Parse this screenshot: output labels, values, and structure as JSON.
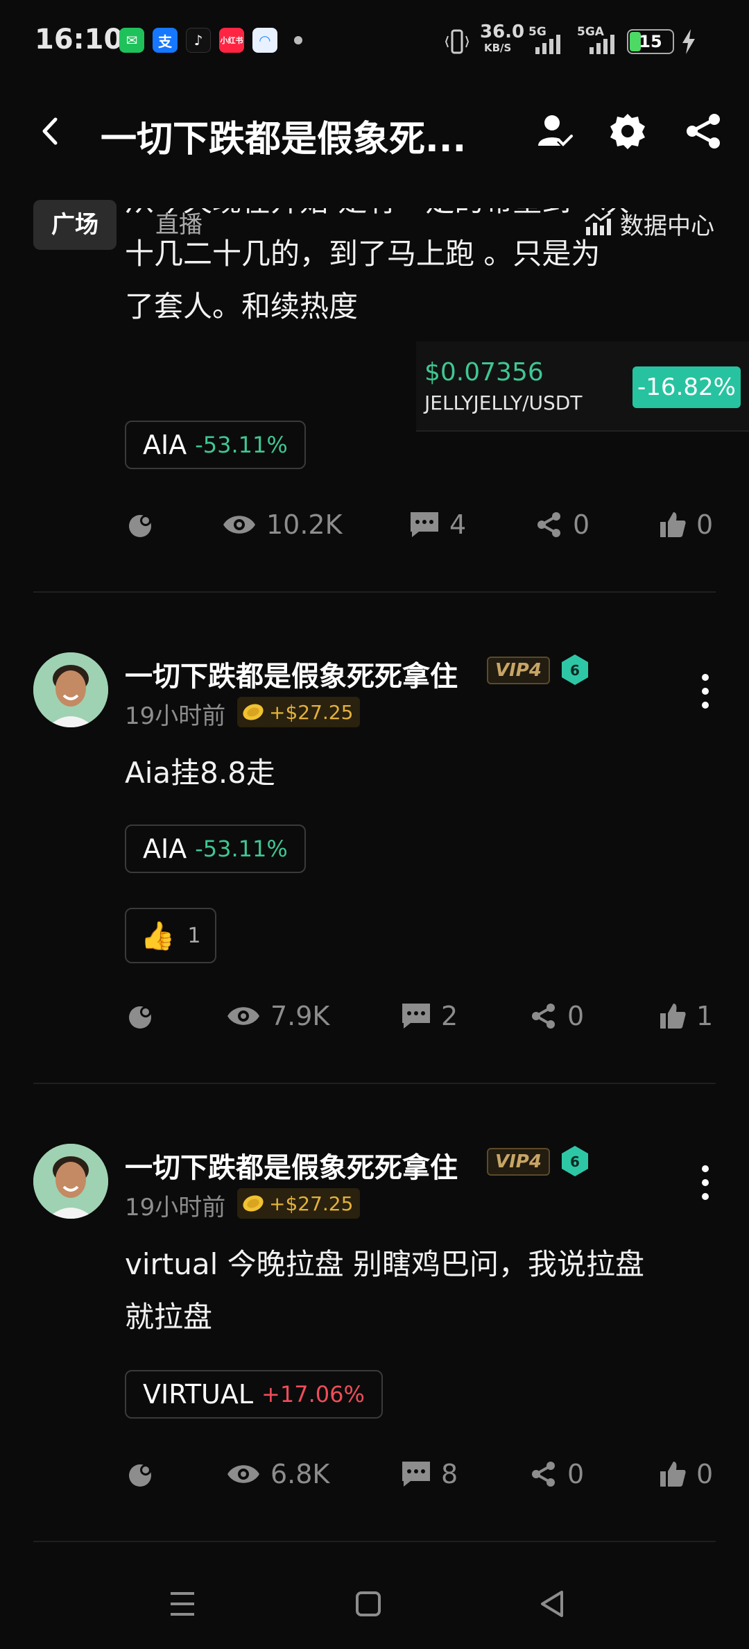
{
  "status_bar": {
    "time": "16:10",
    "apps": [
      {
        "icon": "wechat-icon",
        "color": "#1fc15b",
        "glyph": "✉"
      },
      {
        "icon": "alipay-icon",
        "color": "#1677ff",
        "glyph": "支"
      },
      {
        "icon": "tiktok-icon",
        "color": "#111111",
        "glyph": "♪"
      },
      {
        "icon": "xiaohongshu-icon",
        "color": "#ff2442",
        "glyph": "小红书"
      },
      {
        "icon": "browser-icon",
        "color": "#2e8cff",
        "glyph": "◠"
      }
    ],
    "net_speed": "36.0",
    "net_unit": "KB/S",
    "network_1": "5G",
    "network_2": "5GA",
    "battery": "15"
  },
  "header": {
    "title": "一切下跌都是假象死...",
    "icons": [
      "user-follow-icon",
      "settings-icon",
      "share-icon"
    ]
  },
  "tabs": [
    {
      "label": "广场",
      "active": true
    },
    {
      "label": "直播",
      "active": false
    }
  ],
  "data_center_label": "数据中心",
  "ticker": {
    "price": "$0.07356",
    "pair": "JELLYJELLY/USDT",
    "change": "-16.82%"
  },
  "posts": [
    {
      "text_lines": [
        "从今天现在开始 是有一定的希望到一次",
        "十几二十几的，到了马上跑 。只是为",
        "了套人。和续热度"
      ],
      "token": {
        "symbol": "AIA",
        "change": "-53.11%",
        "direction": "down"
      },
      "stats": {
        "views": "10.2K",
        "comments": "4",
        "shares": "0",
        "likes": "0"
      }
    },
    {
      "author": "一切下跌都是假象死死拿住",
      "vip": "VIP4",
      "level": "6",
      "time": "19小时前",
      "earnings": "+$27.25",
      "text_lines": [
        "Aia挂8.8走"
      ],
      "token": {
        "symbol": "AIA",
        "change": "-53.11%",
        "direction": "down"
      },
      "reaction": {
        "emoji": "👍",
        "count": "1"
      },
      "stats": {
        "views": "7.9K",
        "comments": "2",
        "shares": "0",
        "likes": "1"
      }
    },
    {
      "author": "一切下跌都是假象死死拿住",
      "vip": "VIP4",
      "level": "6",
      "time": "19小时前",
      "earnings": "+$27.25",
      "text_lines": [
        "virtual 今晚拉盘 别瞎鸡巴问，我说拉盘",
        "就拉盘"
      ],
      "token": {
        "symbol": "VIRTUAL",
        "change": "+17.06%",
        "direction": "up"
      },
      "stats": {
        "views": "6.8K",
        "comments": "8",
        "shares": "0",
        "likes": "0"
      }
    }
  ],
  "colors": {
    "background": "#0b0b0b",
    "down": "#3fc793",
    "up": "#ef4d5a",
    "ticker_badge": "#27c3a0",
    "vip_gold": "#c7a566",
    "level_teal": "#2ec7a6"
  }
}
